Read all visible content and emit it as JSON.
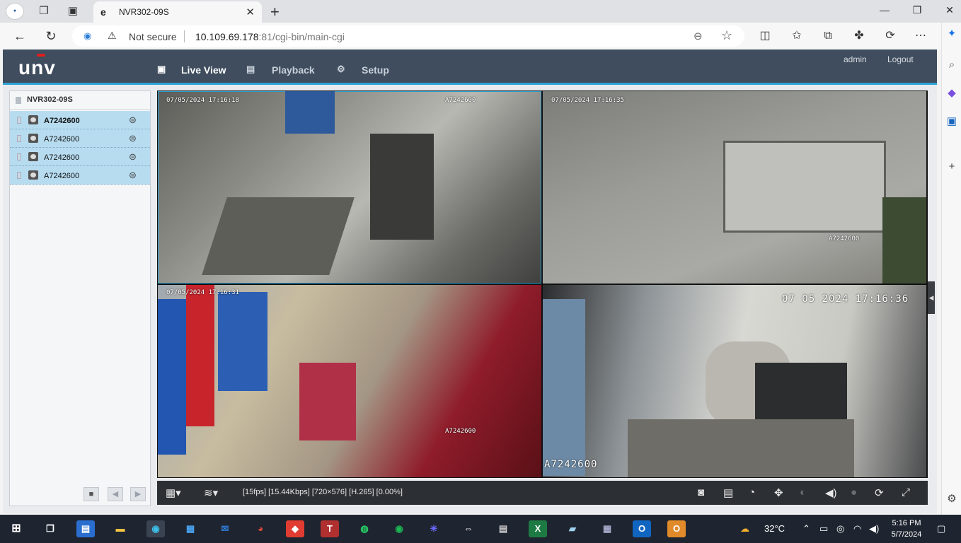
{
  "browser": {
    "tab_title": "NVR302-09S",
    "tab_close": "✕",
    "new_tab": "+",
    "security_label": "Not secure",
    "url_host": "10.109.69.178",
    "url_rest": ":81/cgi-bin/main-cgi"
  },
  "app": {
    "logo": "unv",
    "nav": [
      {
        "label": "Live View",
        "icon": "monitor-icon"
      },
      {
        "label": "Playback",
        "icon": "film-icon"
      },
      {
        "label": "Setup",
        "icon": "gear-icon"
      }
    ],
    "user": "admin",
    "logout": "Logout"
  },
  "sidebar": {
    "device": "NVR302-09S",
    "cameras": [
      {
        "label": "A7242600"
      },
      {
        "label": "A7242600"
      },
      {
        "label": "A7242600"
      },
      {
        "label": "A7242600"
      }
    ]
  },
  "tiles": [
    {
      "time": "07/05/2024 17:16:18",
      "name": "A7242600"
    },
    {
      "time": "07/05/2024 17:16:35",
      "name": "A7242600"
    },
    {
      "time": "07/05/2024 17:16:31",
      "name": "A7242600"
    },
    {
      "time": "07 05 2024 17:16:36",
      "name": "A7242600"
    }
  ],
  "controlbar": {
    "status": "[15fps] [15.44Kbps] [720×576] [H.265] [0.00%]"
  },
  "taskbar": {
    "weather": "32°C",
    "time": "5:16 PM",
    "date": "5/7/2024"
  },
  "colors": {
    "header_bg": "#3f4d5e",
    "accent": "#2ea3d6",
    "selected_row": "#b7dcf0"
  }
}
